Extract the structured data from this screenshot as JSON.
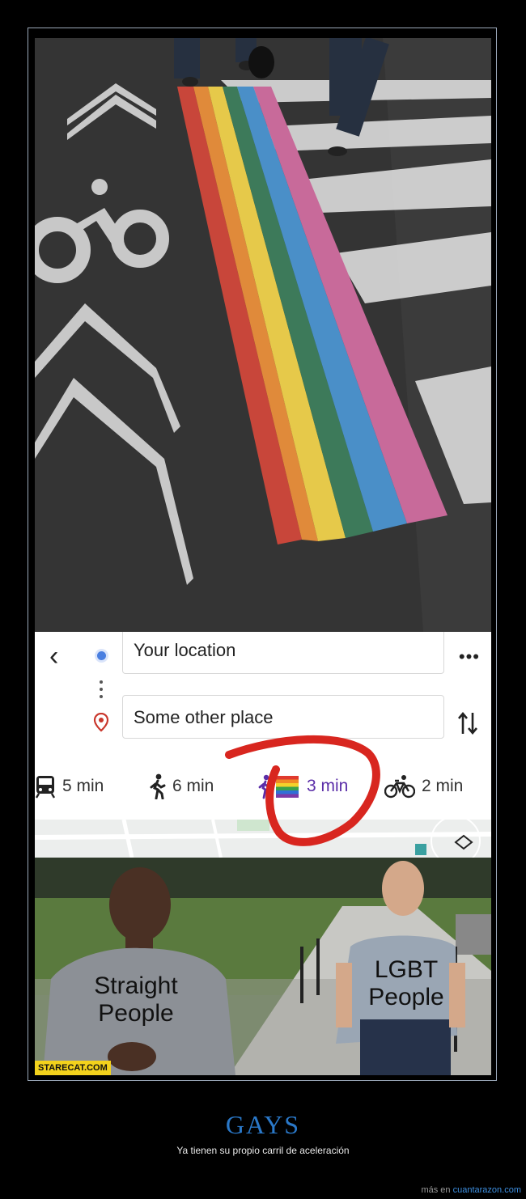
{
  "maps": {
    "origin": "Your location",
    "destination": "Some other place",
    "back_icon": "back-arrow-icon",
    "more_icon": "more-options-icon",
    "swap_icon": "swap-icon",
    "modes": [
      {
        "icon": "transit-icon",
        "time": "5 min"
      },
      {
        "icon": "walking-icon",
        "time": "6 min"
      },
      {
        "icon": "rainbow-walking-icon",
        "time": "3 min",
        "selected": true
      },
      {
        "icon": "bicycle-icon",
        "time": "2 min"
      }
    ],
    "accent_color": "#5b2ea8",
    "annotation_color": "#d8261f"
  },
  "meme": {
    "left_label": "Straight\nPeople",
    "right_label": "LGBT\nPeople",
    "watermark": "STARECAT.COM"
  },
  "caption": {
    "title": "GAYS",
    "subtitle": "Ya tienen su propio carril de aceleración"
  },
  "credit": {
    "prefix": "más en",
    "site": "cuantarazon.com"
  },
  "colors": {
    "title": "#2a78c8",
    "rainbow": [
      "#c8463a",
      "#e08a3a",
      "#e6c94a",
      "#3d7a5a",
      "#4a8fc8",
      "#c86a9a"
    ]
  }
}
